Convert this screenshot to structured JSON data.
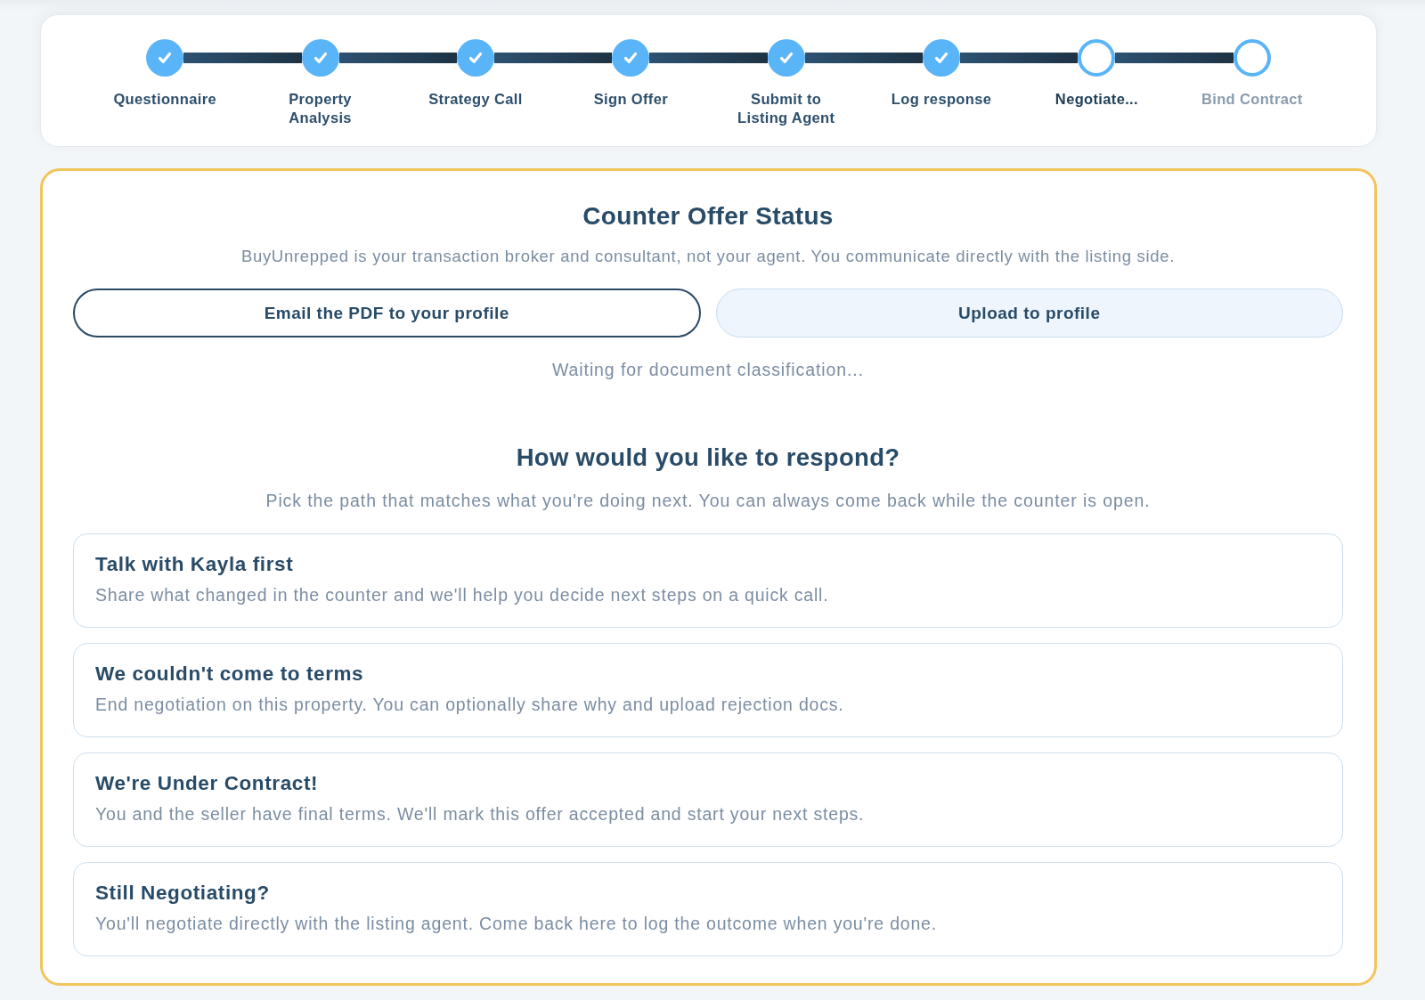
{
  "progress_steps": [
    {
      "label": "Questionnaire",
      "completed": true,
      "current": false
    },
    {
      "label": "Property Analysis",
      "completed": true,
      "current": false
    },
    {
      "label": "Strategy Call",
      "completed": true,
      "current": false
    },
    {
      "label": "Sign Offer",
      "completed": true,
      "current": false
    },
    {
      "label": "Submit to Listing Agent",
      "completed": true,
      "current": false
    },
    {
      "label": "Log response",
      "completed": true,
      "current": false
    },
    {
      "label": "Negotiate...",
      "completed": false,
      "current": true
    },
    {
      "label": "Bind Contract",
      "completed": false,
      "current": false
    }
  ],
  "counter_offer": {
    "title": "Counter Offer Status",
    "note": "BuyUnrepped is your transaction broker and consultant, not your agent. You communicate directly with the listing side.",
    "buttons": [
      {
        "label": "Email the PDF to your profile",
        "kind": "outline"
      },
      {
        "label": "Upload to profile",
        "kind": "soft"
      }
    ],
    "status_text": "Waiting for document classification..."
  },
  "response": {
    "title": "How would you like to respond?",
    "subtitle": "Pick the path that matches what you're doing next. You can always come back while the counter is open.",
    "options": [
      {
        "title": "Talk with Kayla first",
        "description": "Share what changed in the counter and we'll help you decide next steps on a quick call."
      },
      {
        "title": "We couldn't come to terms",
        "description": "End negotiation on this property. You can optionally share why and upload rejection docs."
      },
      {
        "title": "We're Under Contract!",
        "description": "You and the seller have final terms. We'll mark this offer accepted and start your next steps."
      },
      {
        "title": "Still Negotiating?",
        "description": "You'll negotiate directly with the listing agent. Come back here to log the outcome when you're done."
      }
    ]
  }
}
